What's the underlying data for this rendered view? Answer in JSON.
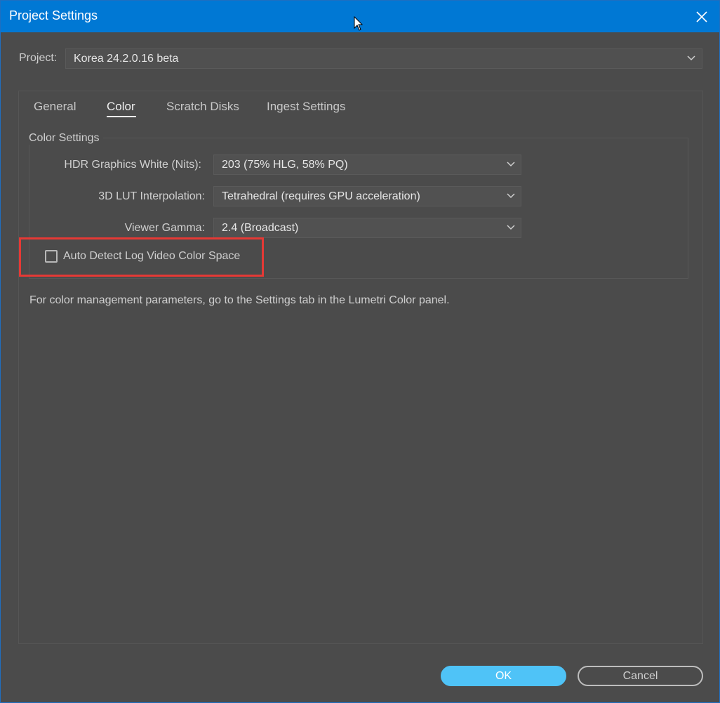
{
  "window": {
    "title": "Project Settings"
  },
  "project": {
    "label": "Project:",
    "value": "Korea 24.2.0.16 beta"
  },
  "tabs": [
    {
      "label": "General",
      "active": false
    },
    {
      "label": "Color",
      "active": true
    },
    {
      "label": "Scratch Disks",
      "active": false
    },
    {
      "label": "Ingest Settings",
      "active": false
    }
  ],
  "color_settings": {
    "group_title": "Color Settings",
    "fields": [
      {
        "label": "HDR Graphics White (Nits):",
        "value": "203 (75% HLG, 58% PQ)"
      },
      {
        "label": "3D LUT Interpolation:",
        "value": "Tetrahedral (requires GPU acceleration)"
      },
      {
        "label": "Viewer Gamma:",
        "value": "2.4 (Broadcast)"
      }
    ],
    "auto_detect": {
      "label": "Auto Detect Log Video Color Space",
      "checked": false
    },
    "note": "For color management parameters, go to the Settings tab in the Lumetri Color panel."
  },
  "buttons": {
    "ok": "OK",
    "cancel": "Cancel"
  },
  "colors": {
    "titlebar": "#0078d4",
    "background": "#4b4b4b",
    "ok_button": "#4fc3f7",
    "highlight": "#e53935"
  },
  "icons": {
    "close": "close-icon",
    "dropdown": "chevron-down-icon",
    "cursor": "mouse-cursor-icon"
  }
}
